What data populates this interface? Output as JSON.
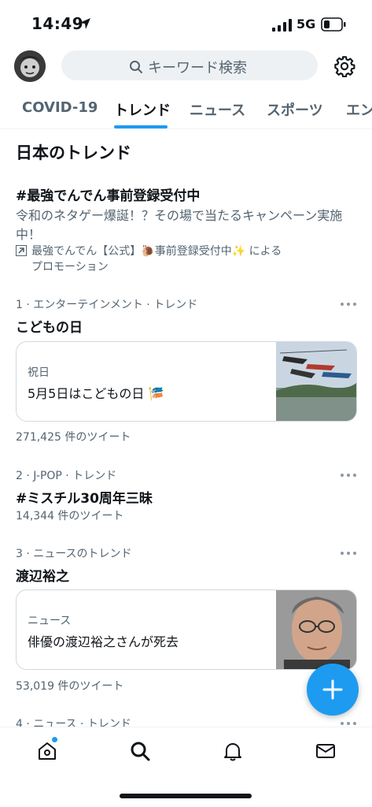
{
  "status": {
    "time": "14:49",
    "network": "5G"
  },
  "header": {
    "search_placeholder": "キーワード検索"
  },
  "tabs": [
    {
      "label": "COVID-19",
      "active": false
    },
    {
      "label": "トレンド",
      "active": true
    },
    {
      "label": "ニュース",
      "active": false
    },
    {
      "label": "スポーツ",
      "active": false
    },
    {
      "label": "エン",
      "active": false
    }
  ],
  "section_title": "日本のトレンド",
  "promoted": {
    "title": "#最強でんでん事前登録受付中",
    "description": "令和のネタゲー爆誕！？その場で当たるキャンペーン実施中！",
    "by_line": "最強でんでん【公式】🐌事前登録受付中✨ による",
    "label": "プロモーション"
  },
  "trends": [
    {
      "meta": "1 · エンターテインメント · トレンド",
      "title": "こどもの日",
      "card": {
        "category": "祝日",
        "text": "5月5日はこどもの日 🎏"
      },
      "count": "271,425 件のツイート"
    },
    {
      "meta": "2 · J-POP · トレンド",
      "title": "#ミスチル30周年三昧",
      "count": "14,344 件のツイート"
    },
    {
      "meta": "3 · ニュースのトレンド",
      "title": "渡辺裕之",
      "card": {
        "category": "ニュース",
        "text": "俳優の渡辺裕之さんが死去"
      },
      "count": "53,019 件のツイート"
    },
    {
      "meta": "4 · ニュース · トレンド"
    }
  ],
  "colors": {
    "accent": "#1d9bf0",
    "secondary_text": "#536471",
    "border": "#cfd9de"
  },
  "icons": [
    "location-arrow-icon",
    "signal-icon",
    "battery-icon",
    "search-icon",
    "gear-icon",
    "promoted-arrow-icon",
    "more-icon",
    "plus-icon",
    "home-icon",
    "search-nav-icon",
    "bell-icon",
    "mail-icon"
  ]
}
